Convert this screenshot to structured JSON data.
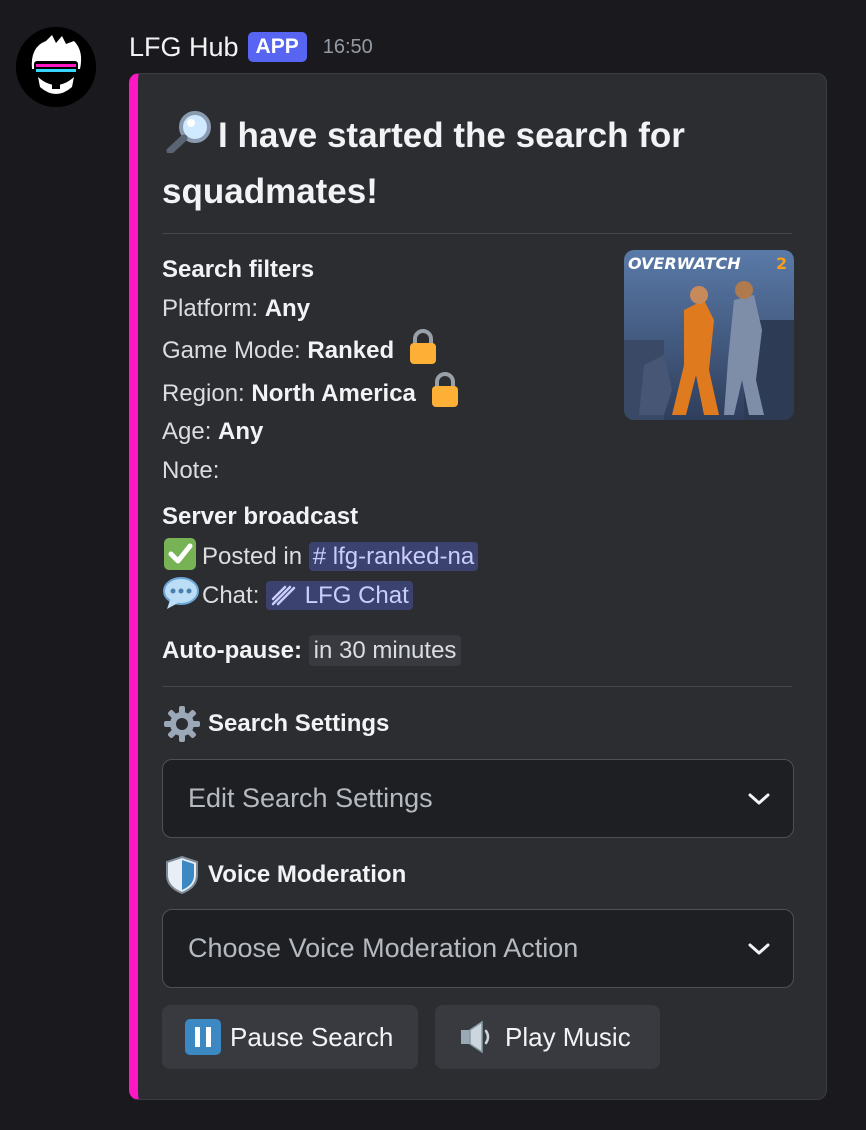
{
  "message": {
    "username": "LFG Hub",
    "badge": "APP",
    "time": "16:50"
  },
  "embed": {
    "accent_color": "#ff16c5",
    "title": "I have started the search for squadmates!",
    "title_icon": "magnifying-glass-icon",
    "thumbnail": {
      "logo_text": "OVERWATCH",
      "logo_number": "2"
    },
    "filters": {
      "heading": "Search filters",
      "platform_label": "Platform:",
      "platform_value": "Any",
      "mode_label": "Game Mode:",
      "mode_value": "Ranked",
      "region_label": "Region:",
      "region_value": "North America",
      "age_label": "Age:",
      "age_value": "Any",
      "note_label": "Note:"
    },
    "broadcast": {
      "heading": "Server broadcast",
      "posted_label": "Posted in",
      "posted_channel": "# lfg-ranked-na",
      "chat_label": "Chat:",
      "chat_channel": "LFG Chat"
    },
    "autopause": {
      "label": "Auto-pause:",
      "value": "in 30 minutes"
    }
  },
  "components": {
    "search_settings_heading": "Search Settings",
    "search_settings_placeholder": "Edit Search Settings",
    "voice_heading": "Voice Moderation",
    "voice_placeholder": "Choose Voice Moderation Action",
    "pause_button": "Pause Search",
    "music_button": "Play Music"
  }
}
